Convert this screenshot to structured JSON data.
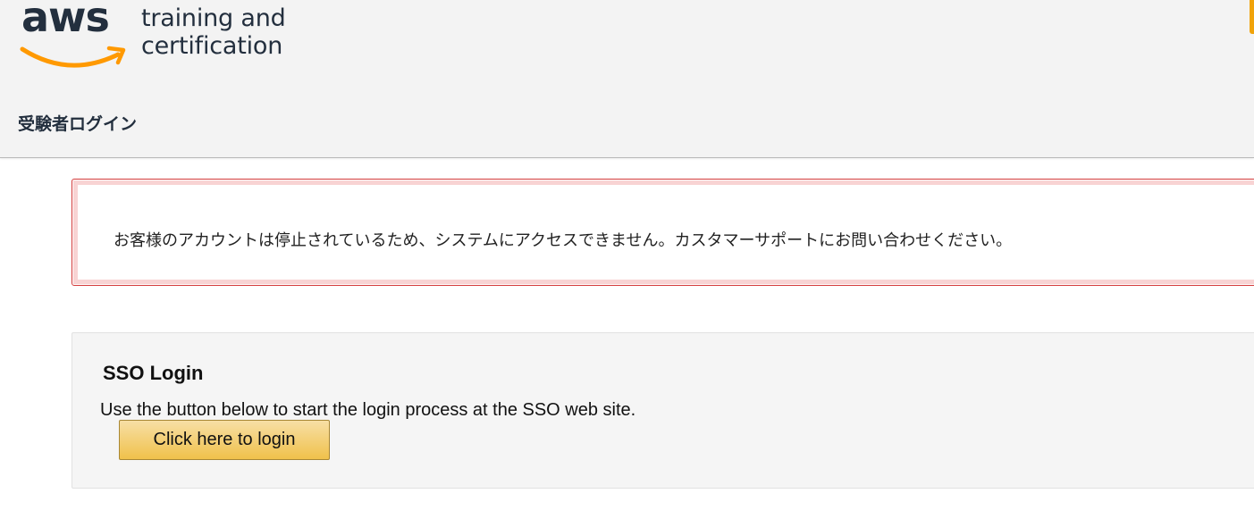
{
  "header": {
    "logo": {
      "brand": "aws",
      "tagline_line1": "training and",
      "tagline_line2": "certification",
      "brand_color": "#232f3e",
      "smile_color": "#ff9900"
    },
    "subtitle": "受験者ログイン",
    "background_color": "#f3f3f3",
    "accent_color": "#f0a30a"
  },
  "alert": {
    "message": "お客様のアカウントは停止されているため、システムにアクセスできません。カスタマーサポートにお問い合わせください。",
    "border_color": "#d43a3a",
    "type": "error"
  },
  "sso": {
    "title": "SSO Login",
    "description": "Use the button below to start the login process at the SSO web site.",
    "button_label": "Click here to login",
    "button_color": "#f0c14b"
  }
}
